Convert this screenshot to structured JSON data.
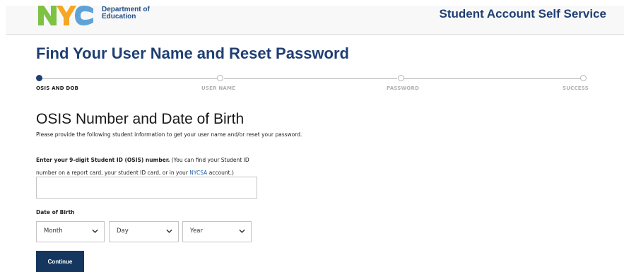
{
  "header": {
    "logo_text": "NYC",
    "department_line1": "Department of",
    "department_line2": "Education",
    "app_title": "Student Account Self Service",
    "logo_colors": {
      "n": "#7dc243",
      "y": "#f5a623",
      "c": "#5ea3d8"
    }
  },
  "page": {
    "title": "Find Your User Name and Reset Password"
  },
  "stepper": {
    "steps": [
      {
        "label": "OSIS AND DOB",
        "active": true
      },
      {
        "label": "USER NAME",
        "active": false
      },
      {
        "label": "PASSWORD",
        "active": false
      },
      {
        "label": "SUCCESS",
        "active": false
      }
    ]
  },
  "form": {
    "section_title": "OSIS Number and Date of Birth",
    "description": "Please provide the following student information to get your user name and/or reset your password.",
    "osis": {
      "label_bold": "Enter your 9-digit Student ID (OSIS) number.",
      "label_text_1": " (You can find your Student ID number on a report card, your student ID card, or in your ",
      "label_link": "NYCSA",
      "label_text_2": " account.)",
      "value": ""
    },
    "dob": {
      "label": "Date of Birth",
      "month": "Month",
      "day": "Day",
      "year": "Year"
    },
    "continue_label": "Continue"
  }
}
